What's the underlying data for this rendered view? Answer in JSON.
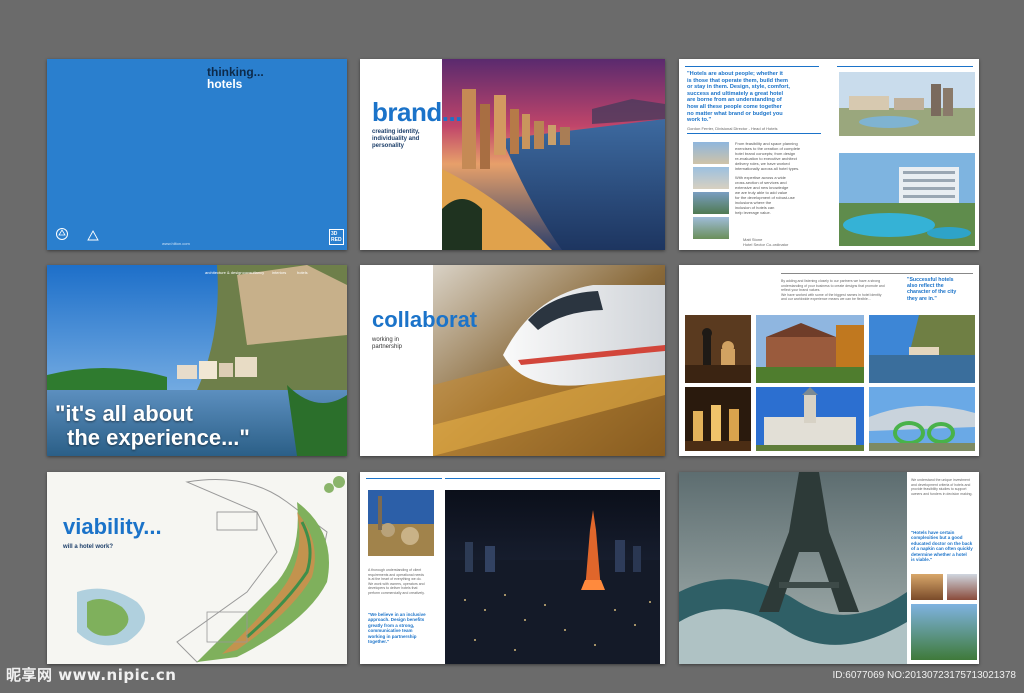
{
  "colors": {
    "background": "#6b6b6b",
    "accent": "#1b73c9",
    "cover_blue": "#2a7fce"
  },
  "p1": {
    "title_line1": "thinking...",
    "title_line2": "hotels",
    "footer_text": "www.hilton.com",
    "badge": "3D\nRED"
  },
  "p2": {
    "heading": "brand...",
    "subheading": "creating identity,\nindividuality and\npersonality"
  },
  "p3": {
    "quote": "\"Hotels are about people; whether it\nis those that operate them, build them\nor stay in them. Design, style, comfort,\nsuccess and ultimately a great hotel\nare borne from an understanding of\nhow all these people come together\nno matter what brand or budget you\nwork to.\"",
    "attribution": "Gordon Ferrier, Divisional Director - Head of Hotels",
    "body1": "From feasibility and space planning\nexercises to the creation of complete\nhotel brand concepts; from design\nre-evaluation to executive architect\ndelivery roles, we have worked\ninternationally across all hotel types.",
    "body2": "With expertise across a wide\ncross-section of services and\nextensive and new knowledge\nwe are truly able to add value\nfor the development of robust-use\ninclusions where the\ninclusion of hotels can\nhelp leverage value.",
    "sign": "Matt Stone\nHotel Sector Co-ordinator"
  },
  "p4": {
    "headline_line1": "\"it's all about",
    "headline_line2": "the experience...\"",
    "nav_items": [
      "architecture & design",
      "consultancy",
      "interiors",
      "hotels"
    ]
  },
  "p5": {
    "heading": "collaborat",
    "subheading": "working in\npartnership"
  },
  "p6": {
    "quote": "\"Successful hotels\nalso reflect the\ncharacter of the city\nthey are in.\"",
    "body": "By adding and listening closely to our partners we have a strong\nunderstanding of your business to create designs that promote and\nreflect your brand values.\nWe have worked with some of the biggest names in hotel identity\nand our worldwide experience means we can be flexible..."
  },
  "p7": {
    "heading": "viability...",
    "subheading": "will a hotel work?"
  },
  "p8": {
    "quote": "\"We believe in an inclusive\napproach. Design benefits\ngreatly from a strong,\ncommunicative team\nworking in partnership\ntogether.\"",
    "body": "A thorough understanding of client\nrequirements and operational needs\nis at the heart of everything we do.\nWe work with owners, operators and\ndevelopers to deliver hotels that\nperform commercially and creatively."
  },
  "p9": {
    "quote": "\"Hotels have certain\ncomplexities but a good\neducated doctor on the back\nof a napkin can often quickly\ndetermine whether a hotel\nis viable.\"",
    "body": "We understand the unique investment\nand development criteria of hotels and\nprovide feasibility studies to support\nowners and funders in decision making."
  },
  "watermark": {
    "logo_text": "昵享网 www.nipic.cn",
    "id_text": "ID:6077069 NO:20130723175713021378"
  }
}
